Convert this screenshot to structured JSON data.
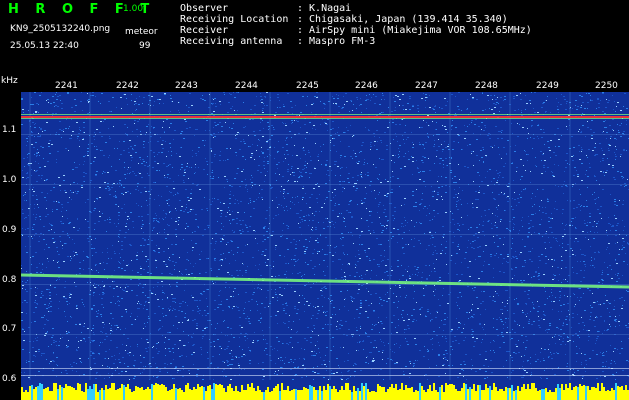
{
  "header": {
    "title": "H R O F F T",
    "version": "1.00f",
    "filename": "KN9_2505132240.png",
    "meteor_label": "meteor",
    "date": "25.05.13 22:40",
    "meteor_count": "99",
    "info": [
      {
        "label": "Observer",
        "value": ": K.Nagai"
      },
      {
        "label": "Receiving Location",
        "value": ": Chigasaki, Japan (139.414 35.340)"
      },
      {
        "label": "Receiver",
        "value": ": AirSpy mini (Miakejima VOR 108.65MHz)"
      },
      {
        "label": "Receiving antenna",
        "value": ": Maspro FM-3"
      }
    ]
  },
  "axis": {
    "unit": "kHz",
    "y_ticks": [
      "1.1",
      "1.0",
      "0.9",
      "0.8",
      "0.7",
      "0.6"
    ],
    "x_ticks": [
      "2241",
      "2242",
      "2243",
      "2244",
      "2245",
      "2246",
      "2247",
      "2248",
      "2249",
      "2250"
    ]
  },
  "colors": {
    "background": "#000000",
    "spectrogram_base": "#10309a",
    "noise_light": "#2a7ee8",
    "carrier_line": "#ff3333",
    "signal_line": "#7dff7d",
    "title_green": "#00ff00",
    "bottom_band": "#ffff00"
  }
}
